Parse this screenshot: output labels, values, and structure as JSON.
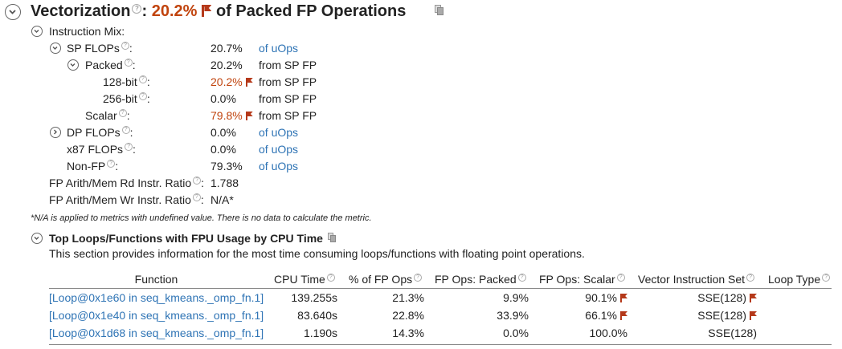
{
  "header": {
    "title": "Vectorization",
    "colon": ":",
    "percent": "20.2%",
    "suffix": "of Packed FP Operations"
  },
  "instruction_mix": {
    "label": "Instruction Mix:",
    "rows": [
      {
        "label": "SP FLOPs",
        "colon": ":",
        "value": "20.7%",
        "unit": "of uOps",
        "unit_style": "link"
      },
      {
        "label": "Packed",
        "colon": ":",
        "value": "20.2%",
        "unit": "from SP FP",
        "unit_style": "plain"
      },
      {
        "label": "128-bit",
        "colon": ":",
        "value": "20.2%",
        "unit": "from SP FP",
        "unit_style": "plain",
        "flagged": true
      },
      {
        "label": "256-bit",
        "colon": ":",
        "value": "0.0%",
        "unit": "from SP FP",
        "unit_style": "plain"
      },
      {
        "label": "Scalar",
        "colon": ":",
        "value": "79.8%",
        "unit": "from SP FP",
        "unit_style": "plain",
        "flagged": true
      },
      {
        "label": "DP FLOPs",
        "colon": ":",
        "value": "0.0%",
        "unit": "of uOps",
        "unit_style": "link"
      },
      {
        "label": "x87 FLOPs",
        "colon": ":",
        "value": "0.0%",
        "unit": "of uOps",
        "unit_style": "link"
      },
      {
        "label": "Non-FP",
        "colon": ":",
        "value": "79.3%",
        "unit": "of uOps",
        "unit_style": "link"
      }
    ],
    "ratios": [
      {
        "label": "FP Arith/Mem Rd Instr. Ratio",
        "colon": ":",
        "value": "1.788"
      },
      {
        "label": "FP Arith/Mem Wr Instr. Ratio",
        "colon": ":",
        "value": "N/A*"
      }
    ]
  },
  "note": "*N/A is applied to metrics with undefined value. There is no data to calculate the metric.",
  "top_loops": {
    "title": "Top Loops/Functions with FPU Usage by CPU Time",
    "description": "This section provides information for the most time consuming loops/functions with floating point operations.",
    "columns": [
      "Function",
      "CPU Time",
      "% of FP Ops",
      "FP Ops: Packed",
      "FP Ops: Scalar",
      "Vector Instruction Set",
      "Loop Type"
    ],
    "rows": [
      {
        "function": "[Loop@0x1e60 in seq_kmeans._omp_fn.1]",
        "cpu_time": "139.255s",
        "fp_ops": "21.3%",
        "packed": "9.9%",
        "scalar": "90.1%",
        "scalar_flag": true,
        "vis": "SSE(128)",
        "vis_flag": true,
        "loop_type": ""
      },
      {
        "function": "[Loop@0x1e40 in seq_kmeans._omp_fn.1]",
        "cpu_time": "83.640s",
        "fp_ops": "22.8%",
        "packed": "33.9%",
        "scalar": "66.1%",
        "scalar_flag": true,
        "vis": "SSE(128)",
        "vis_flag": true,
        "loop_type": ""
      },
      {
        "function": "[Loop@0x1d68 in seq_kmeans._omp_fn.1]",
        "cpu_time": "1.190s",
        "fp_ops": "14.3%",
        "packed": "0.0%",
        "scalar": "100.0%",
        "scalar_flag": false,
        "vis": "SSE(128)",
        "vis_flag": false,
        "loop_type": ""
      }
    ]
  },
  "icons": {
    "collapse": "collapse-icon",
    "expand": "expand-icon",
    "help": "help-icon",
    "flag": "flag-icon",
    "copy": "copy-icon"
  },
  "colors": {
    "accent_red": "#c1440e",
    "link_blue": "#2f74b5"
  }
}
